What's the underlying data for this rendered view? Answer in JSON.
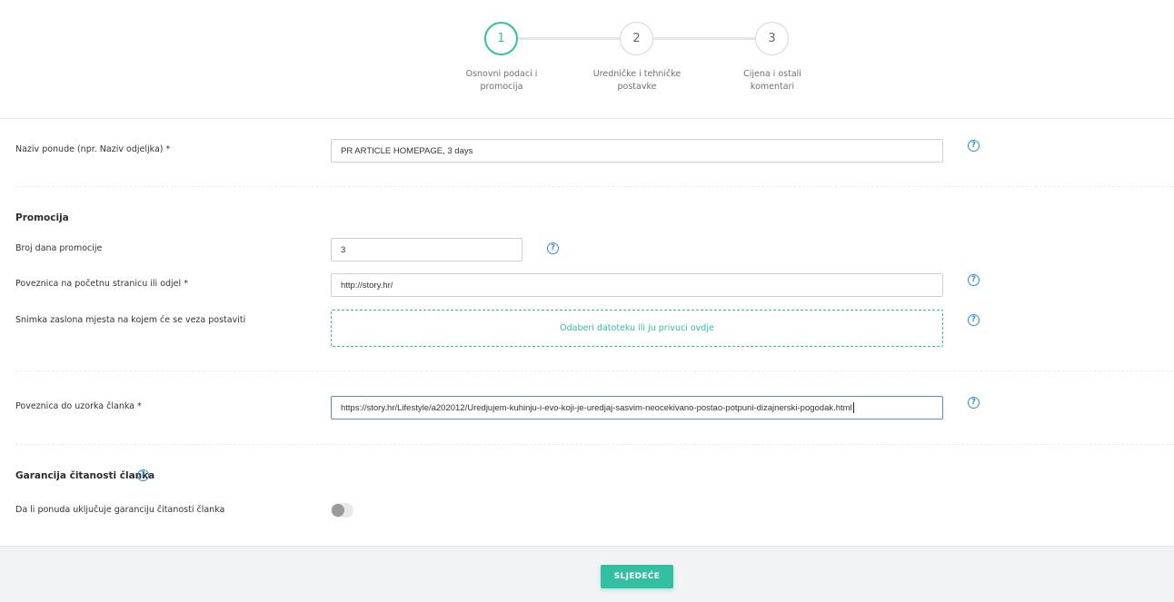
{
  "stepper": {
    "steps": [
      {
        "number": "1",
        "label_line1": "Osnovni podaci i",
        "label_line2": "promocija"
      },
      {
        "number": "2",
        "label_line1": "Uredničke i tehničke",
        "label_line2": "postavke"
      },
      {
        "number": "3",
        "label_line1": "Cijena i ostali",
        "label_line2": "komentari"
      }
    ],
    "active_step": 1
  },
  "form": {
    "offer_name": {
      "label": "Naziv ponude (npr. Naziv odjeljka) *",
      "value": "PR ARTICLE HOMEPAGE, 3 days"
    },
    "promotion": {
      "title": "Promocija",
      "days": {
        "label": "Broj dana promocije",
        "value": "3"
      },
      "homepage_link": {
        "label": "Poveznica na početnu stranicu ili odjel *",
        "value": "http://story.hr/"
      },
      "screenshot": {
        "label": "Snimka zaslona mjesta na kojem će se veza postaviti",
        "dropzone_text": "Odaberi datoteku ili ju privuci ovdje"
      }
    },
    "sample_link": {
      "label": "Poveznica do uzorka članka *",
      "value": "https://story.hr/Lifestyle/a202012/Uredjujem-kuhinju-i-evo-koji-je-uredjaj-sasvim-neocekivano-postao-potpuni-dizajnerski-pogodak.html"
    },
    "read_guarantee": {
      "title": "Garancija čitanosti članka",
      "toggle_label": "Da li ponuda uključuje garanciju čitanosti članka",
      "enabled": false
    }
  },
  "help_icon_glyph": "?",
  "footer": {
    "next_label": "SLJEDEĆE"
  },
  "colors": {
    "accent": "#34bfa3",
    "help": "#2f8fd6",
    "focus_border": "#5b8dd6"
  }
}
